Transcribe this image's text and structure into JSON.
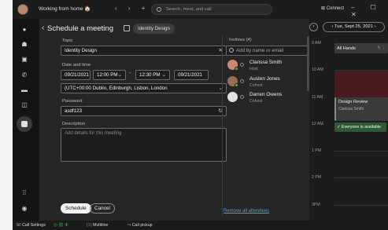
{
  "titlebar": {
    "status": "Working from home",
    "status_emoji": "🏠",
    "nav": "‹ › +",
    "search_placeholder": "Search, meet, and call",
    "connect": "Connect",
    "window_controls": "– ☐ ✕"
  },
  "dialog": {
    "back": "‹",
    "title": "Schedule a meeting",
    "space": "Identity Design",
    "topic_label": "Topic",
    "topic_value": "Identity Design",
    "datetime_label": "Date and time",
    "start_date": "09/21/2021",
    "start_time": "12:00 PM",
    "dash": "-",
    "end_time": "12:30 PM",
    "end_date": "09/21/2021",
    "timezone": "(UTC+00:00 Dublin, Edinburgh, Lisbon, London",
    "password_label": "Password",
    "password_value": "asdf123",
    "description_label": "Description",
    "description_placeholder": "Add details for this meeting",
    "schedule_button": "Schedule",
    "cancel_button": "Cancel"
  },
  "invitees": {
    "title": "Invitees (4)",
    "search_placeholder": "Add by name or email",
    "people": [
      {
        "name": "Clarissa Smith",
        "role": "Host",
        "color": "#c98a6b"
      },
      {
        "name": "Austen Jones",
        "role": "Cohost",
        "color": "#9a6d52"
      },
      {
        "name": "Darren Owens",
        "role": "Cohost",
        "color": "#e2e2e2"
      }
    ],
    "remove_all": "Remove all attendees"
  },
  "calendar": {
    "date": "Tue, Sept 25, 2021",
    "hours": [
      "9 AM",
      "10 AM",
      "11 AM",
      "12 AM",
      "1 PM",
      "2 PM",
      "3PM"
    ],
    "events": [
      {
        "title": "All Hands"
      },
      {
        "title": "Design Review",
        "sub": "Clarissa Smith"
      }
    ],
    "availability": "Everyone is available"
  },
  "bottombar": {
    "call_settings": "Call Settings",
    "multiline": "Multiline",
    "call_pickup": "Call pickup"
  },
  "colors": {
    "accent": "#4a9ee8",
    "available": "#3fb950",
    "busy_block": "#4a1a1f"
  }
}
